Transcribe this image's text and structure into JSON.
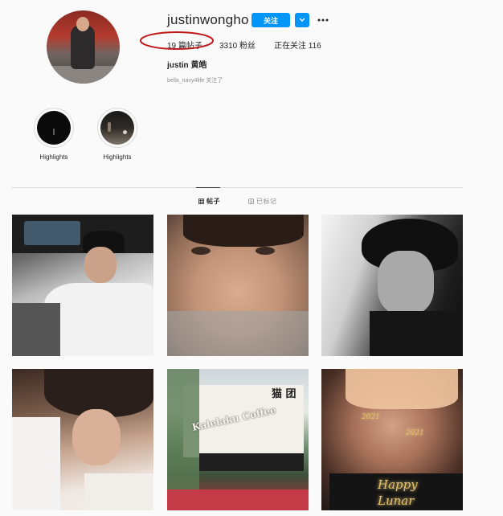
{
  "profile": {
    "username": "justinwongho",
    "follow_label": "关注",
    "stats": {
      "posts_count": "19",
      "posts_label": "篇帖子",
      "followers_count": "3310",
      "followers_label": "粉丝",
      "following_label": "正在关注",
      "following_count": "116"
    },
    "full_name": "justin 黄皓",
    "followed_by": "bella_navy4life 关注了"
  },
  "highlights": [
    {
      "label": "Highlights"
    },
    {
      "label": "Highlights"
    }
  ],
  "tabs": {
    "posts_label": "帖子",
    "tagged_label": "已标记"
  },
  "posts": {
    "post5_sign_text": "Kalelaku Coffee",
    "post5_cn_text": "猫 团",
    "post6_year_left": "2021",
    "post6_year_right": "2021",
    "post6_line1": "Happy",
    "post6_line2": "Lunar"
  },
  "colors": {
    "follow_button": "#0095f6",
    "annotation_circle": "#c0191b",
    "divider": "#dbdbdb"
  },
  "icons": [
    "chevron-down-icon",
    "more-dots-icon",
    "grid-icon",
    "tag-icon"
  ]
}
